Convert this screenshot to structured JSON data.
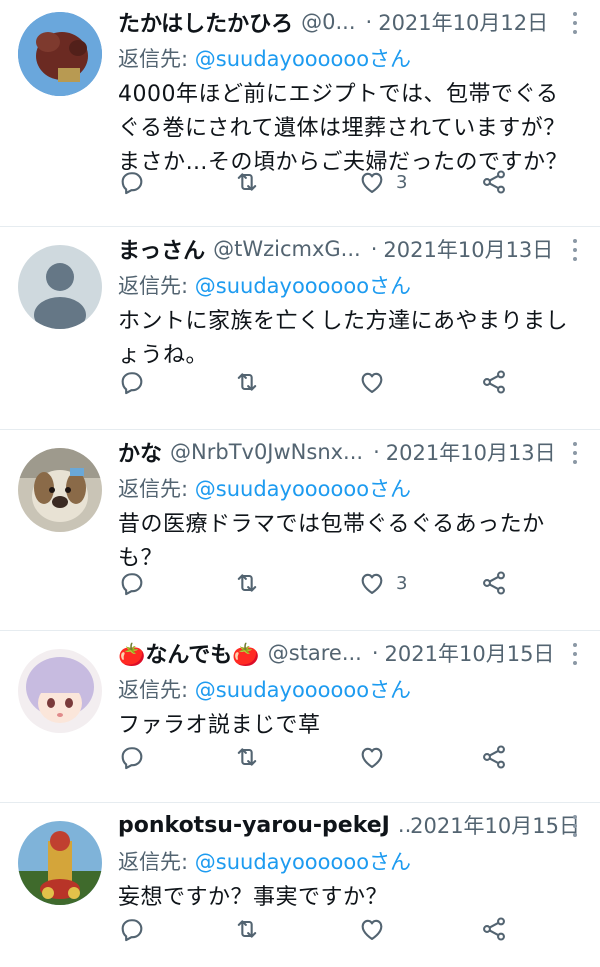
{
  "replies": [
    {
      "name": "たかはしたかひろ",
      "handle": "@0...",
      "date": "2021年10月12日",
      "reply_prefix": "返信先: ",
      "reply_to": "@suudayoooooo",
      "reply_suffix": "さん",
      "text": "4000年ほど前にエジプトでは、包帯でぐるぐる巻にされて遺体は埋葬されていますが？まさか…その頃からご夫婦だったのですか？",
      "like_count": "3"
    },
    {
      "name": "まっさん",
      "handle": "@tWzicmxG...",
      "date": "2021年10月13日",
      "reply_prefix": "返信先: ",
      "reply_to": "@suudayoooooo",
      "reply_suffix": "さん",
      "text": "ホントに家族を亡くした方達にあやまりましょうね。",
      "like_count": ""
    },
    {
      "name": "かな",
      "handle": "@NrbTv0JwNsnx...",
      "date": "2021年10月13日",
      "reply_prefix": "返信先: ",
      "reply_to": "@suudayoooooo",
      "reply_suffix": "さん",
      "text": "昔の医療ドラマでは包帯ぐるぐるあったかも？",
      "like_count": "3"
    },
    {
      "name": "🍅なんでも🍅",
      "handle": "@stare...",
      "date": "2021年10月15日",
      "reply_prefix": "返信先: ",
      "reply_to": "@suudayoooooo",
      "reply_suffix": "さん",
      "text": "ファラオ説まじで草",
      "like_count": ""
    },
    {
      "name": "ponkotsu-yarou-pekeJ",
      "handle": "...",
      "date": "2021年10月15日",
      "reply_prefix": "返信先: ",
      "reply_to": "@suudayoooooo",
      "reply_suffix": "さん",
      "text": "妄想ですか？事実ですか？",
      "like_count": ""
    }
  ],
  "colors": {
    "link": "#1d9bf0",
    "muted": "#536471",
    "divider": "#e6ecf0"
  },
  "icons": [
    "reply-icon",
    "retweet-icon",
    "like-icon",
    "share-icon",
    "more-icon"
  ]
}
